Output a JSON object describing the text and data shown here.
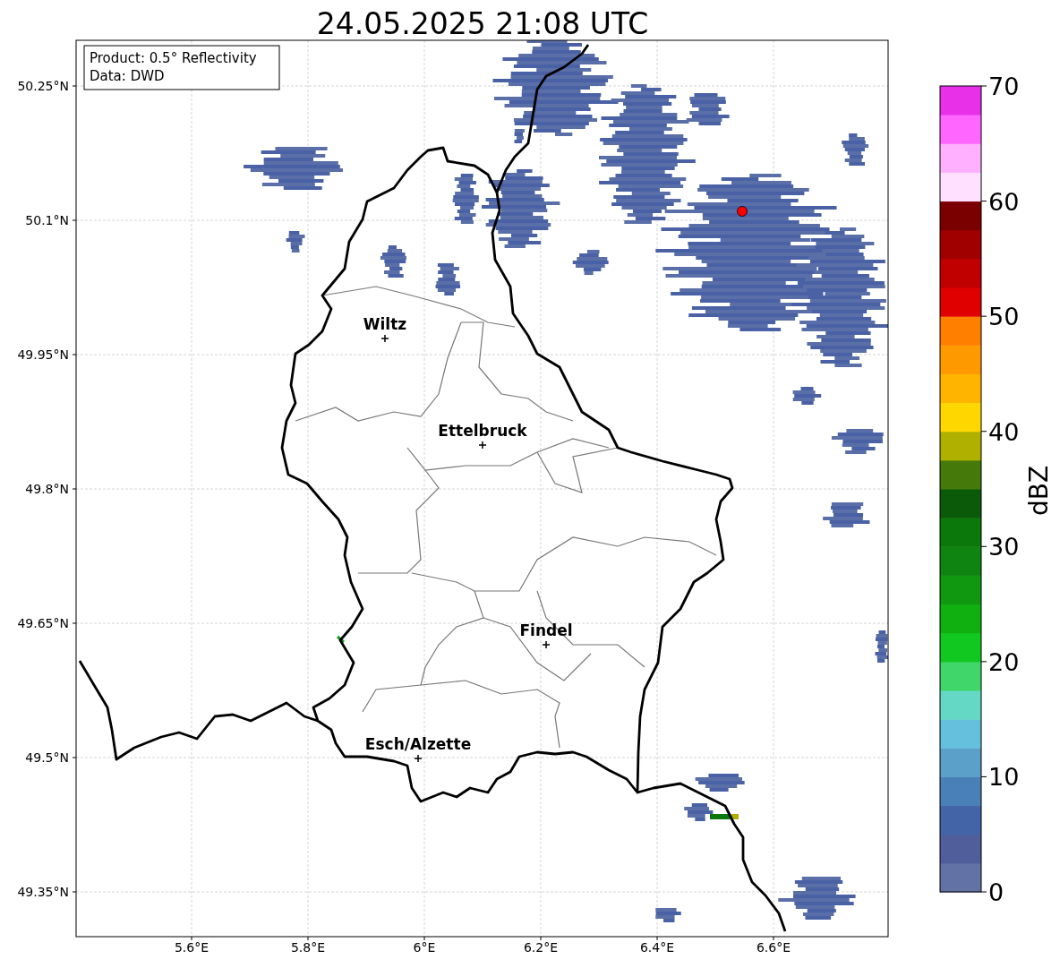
{
  "title": "24.05.2025 21:08 UTC",
  "info_box": {
    "lines": [
      "Product: 0.5° Reflectivity",
      "Data: DWD"
    ]
  },
  "map": {
    "lat_ticks": [
      "50.25°N",
      "50.1°N",
      "49.95°N",
      "49.8°N",
      "49.65°N",
      "49.5°N",
      "49.35°N"
    ],
    "lon_ticks": [
      "5.6°E",
      "5.8°E",
      "6°E",
      "6.2°E",
      "6.4°E",
      "6.6°E"
    ],
    "cities": [
      {
        "name": "Wiltz"
      },
      {
        "name": "Ettelbruck"
      },
      {
        "name": "Findel"
      },
      {
        "name": "Esch/Alzette"
      }
    ]
  },
  "colorbar": {
    "label": "dBZ",
    "ticks": [
      "70",
      "60",
      "50",
      "40",
      "30",
      "20",
      "10",
      "0"
    ],
    "segments": [
      {
        "color": "#6272a4"
      },
      {
        "color": "#505f9c"
      },
      {
        "color": "#4464a8"
      },
      {
        "color": "#4a80b8"
      },
      {
        "color": "#5aa0c8"
      },
      {
        "color": "#64c0dc"
      },
      {
        "color": "#64d8c4"
      },
      {
        "color": "#40d66a"
      },
      {
        "color": "#10c820"
      },
      {
        "color": "#10b010"
      },
      {
        "color": "#109810"
      },
      {
        "color": "#108410"
      },
      {
        "color": "#0a780a"
      },
      {
        "color": "#0a5a0a"
      },
      {
        "color": "#457a0a"
      },
      {
        "color": "#b0b000"
      },
      {
        "color": "#ffd700"
      },
      {
        "color": "#ffb400"
      },
      {
        "color": "#ff9900"
      },
      {
        "color": "#ff7f00"
      },
      {
        "color": "#e00000"
      },
      {
        "color": "#c00000"
      },
      {
        "color": "#a00000"
      },
      {
        "color": "#7a0000"
      },
      {
        "color": "#ffe0ff"
      },
      {
        "color": "#ffb0ff"
      },
      {
        "color": "#ff66ff"
      },
      {
        "color": "#e930e9"
      }
    ]
  }
}
